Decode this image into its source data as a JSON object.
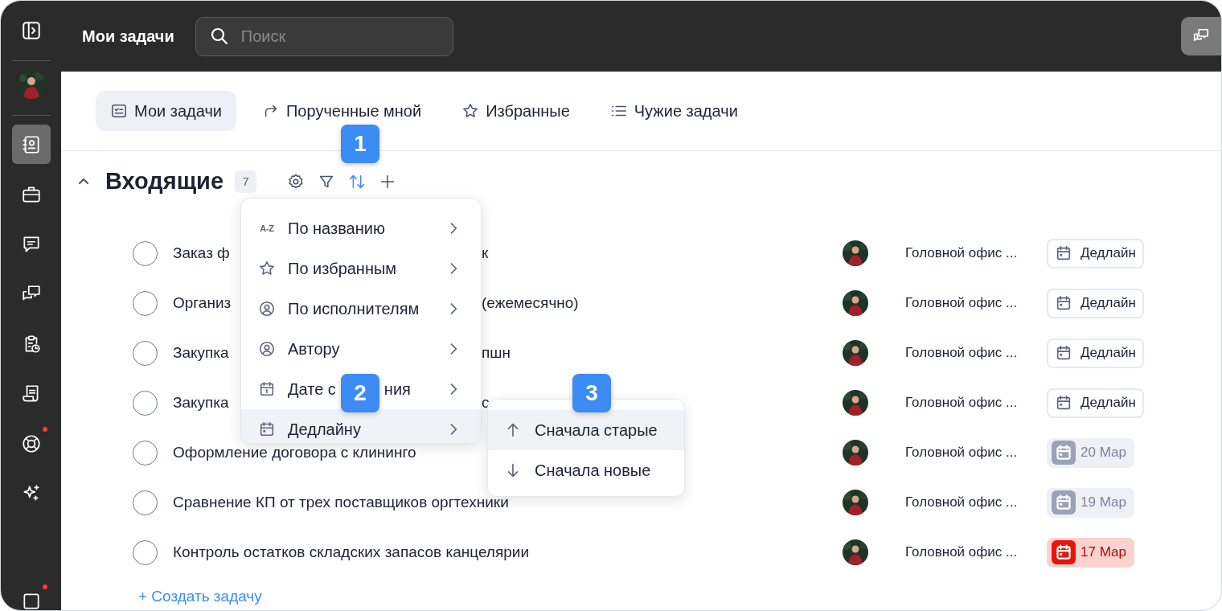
{
  "sidebar": {
    "items": [
      {
        "selected": false,
        "dot": false
      },
      {
        "selected": true,
        "dot": false
      },
      {
        "selected": false,
        "dot": false
      },
      {
        "selected": false,
        "dot": false
      },
      {
        "selected": false,
        "dot": false
      },
      {
        "selected": false,
        "dot": false
      },
      {
        "selected": false,
        "dot": false
      },
      {
        "selected": false,
        "dot": true
      },
      {
        "selected": false,
        "dot": false
      },
      {
        "selected": false,
        "dot": true
      }
    ]
  },
  "header": {
    "title": "Мои задачи",
    "search": {
      "placeholder": "Поиск"
    }
  },
  "tabs": [
    {
      "label": "Мои задачи",
      "selected": true
    },
    {
      "label": "Порученные мной",
      "selected": false
    },
    {
      "label": "Избранные",
      "selected": false
    },
    {
      "label": "Чужие задачи",
      "selected": false
    }
  ],
  "section": {
    "title": "Входящие",
    "count": "7",
    "expanded": true,
    "tools": [
      {
        "active": false
      },
      {
        "active": false
      },
      {
        "active": true
      },
      {
        "active": false
      }
    ]
  },
  "tasks": [
    {
      "checked": false,
      "title": [
        "Заказ ф",
        "к"
      ],
      "org": "Головной офис ...",
      "deadline": {
        "kind": "empty",
        "label": "Дедлайн"
      }
    },
    {
      "checked": false,
      "title": [
        "Организ",
        "(ежемесячно)"
      ],
      "org": "Головной офис ...",
      "deadline": {
        "kind": "empty",
        "label": "Дедлайн"
      }
    },
    {
      "checked": false,
      "title": [
        "Закупка",
        "пшн"
      ],
      "org": "Головной офис ...",
      "deadline": {
        "kind": "empty",
        "label": "Дедлайн"
      }
    },
    {
      "checked": false,
      "title": [
        "Закупка",
        "с"
      ],
      "org": "Головной офис ...",
      "deadline": {
        "kind": "empty",
        "label": "Дедлайн"
      }
    },
    {
      "checked": false,
      "title": [
        "Оформление договора с клининго"
      ],
      "org": "Головной офис ...",
      "deadline": {
        "kind": "upcoming",
        "label": "20 Мар"
      }
    },
    {
      "checked": false,
      "title": [
        "Сравнение КП от трех поставщиков оргтехники"
      ],
      "org": "Головной офис ...",
      "deadline": {
        "kind": "upcoming",
        "label": "19 Мар"
      }
    },
    {
      "checked": false,
      "title": [
        "Контроль остатков складских запасов канцелярии"
      ],
      "org": "Головной офис ...",
      "deadline": {
        "kind": "overdue",
        "label": "17 Мар"
      }
    }
  ],
  "create_task": "+ Создать задачу",
  "sort_menu": {
    "items": [
      {
        "icon_text": "A-Z",
        "label": "По названию",
        "selected": false
      },
      {
        "label": "По избранным",
        "selected": false
      },
      {
        "label": "По исполнителям",
        "selected": false
      },
      {
        "label": "Автору",
        "selected": false
      },
      {
        "label": "Дате с",
        "label_end": "ния",
        "selected": false
      },
      {
        "label": "Дедлайну",
        "selected": true
      }
    ],
    "submenu": [
      {
        "label": "Сначала старые",
        "selected": true
      },
      {
        "label": "Сначала новые",
        "selected": false
      }
    ]
  },
  "markers": [
    "1",
    "2",
    "3"
  ]
}
